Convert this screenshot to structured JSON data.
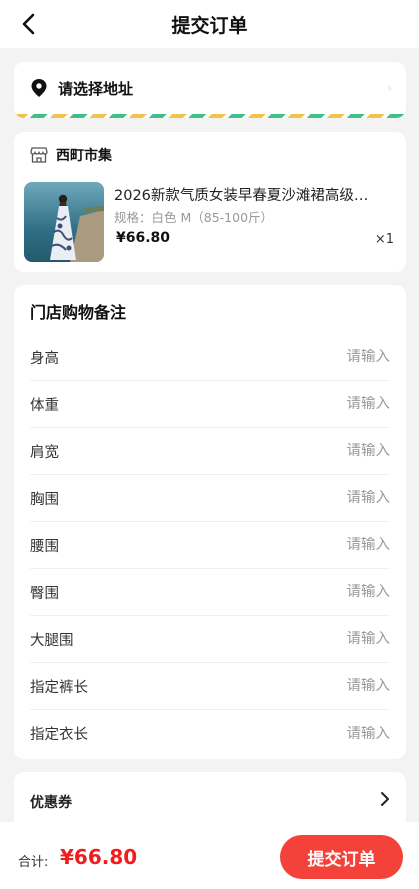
{
  "header": {
    "title": "提交订单"
  },
  "address": {
    "placeholder_text": "请选择地址"
  },
  "shop": {
    "name": "西町市集",
    "product": {
      "title": "2026新款气质女装早春夏沙滩裙高级…",
      "spec": "规格：白色 M（85-100斤）",
      "price": "¥66.80",
      "quantity": "×1"
    }
  },
  "notes": {
    "title": "门店购物备注",
    "placeholder": "请输入",
    "fields": [
      {
        "label": "身高"
      },
      {
        "label": "体重"
      },
      {
        "label": "肩宽"
      },
      {
        "label": "胸围"
      },
      {
        "label": "腰围"
      },
      {
        "label": "臀围"
      },
      {
        "label": "大腿围"
      },
      {
        "label": "指定裤长"
      },
      {
        "label": "指定衣长"
      }
    ]
  },
  "coupon": {
    "label": "优惠券"
  },
  "footer": {
    "total_label": "合计:",
    "total_amount": "¥66.80",
    "submit_label": "提交订单"
  },
  "colors": {
    "accent": "#f4413a",
    "price_red": "#f21c1c",
    "stripe_yellow": "#f2c34a",
    "stripe_green": "#3fbf8a"
  }
}
